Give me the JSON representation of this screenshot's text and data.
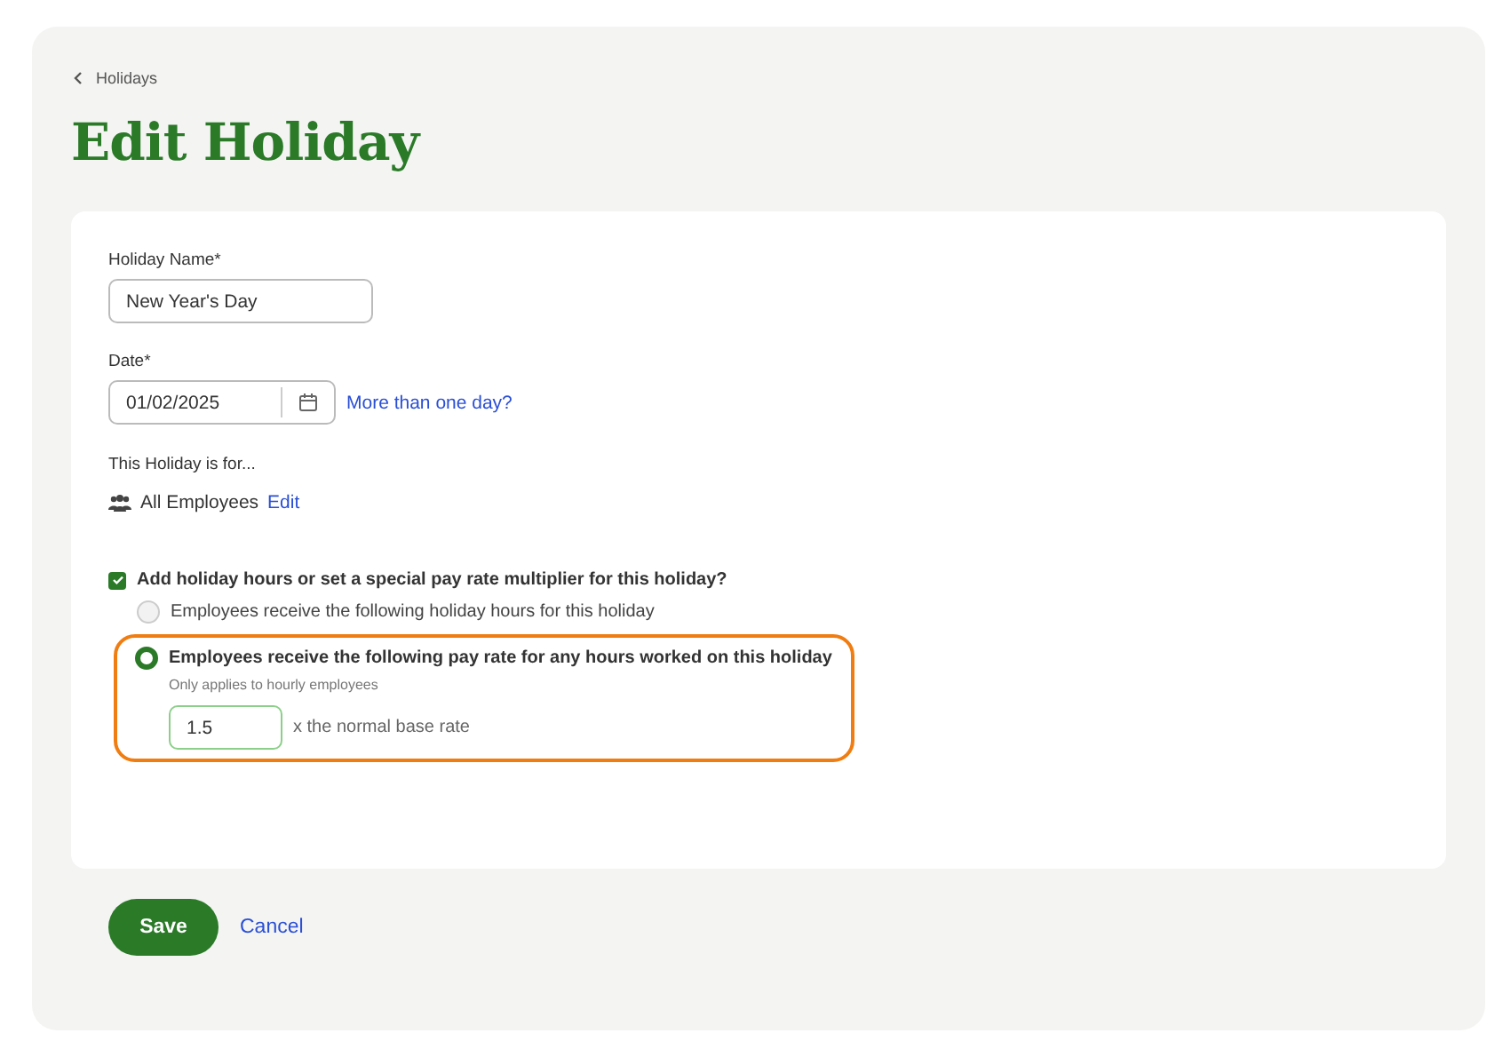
{
  "breadcrumb": {
    "label": "Holidays"
  },
  "title": "Edit Holiday",
  "form": {
    "name_field": {
      "label": "Holiday Name*",
      "value": "New Year's Day"
    },
    "date_field": {
      "label": "Date*",
      "value": "01/02/2025",
      "link": "More than one day?"
    },
    "assignees": {
      "label": "This Holiday is for...",
      "value": "All Employees",
      "link": "Edit"
    },
    "extra_pay": {
      "label": "Add holiday hours or set a special pay rate multiplier for this holiday?",
      "checked": true,
      "options": [
        {
          "label": "Employees receive the following holiday hours for this holiday",
          "selected": false
        },
        {
          "label": "Employees receive the following pay rate for any hours worked on this holiday",
          "selected": true,
          "note": "Only applies to hourly employees",
          "value": "1.5",
          "suffix": "x the normal base rate"
        }
      ]
    }
  },
  "buttons": {
    "save": "Save",
    "cancel": "Cancel"
  }
}
